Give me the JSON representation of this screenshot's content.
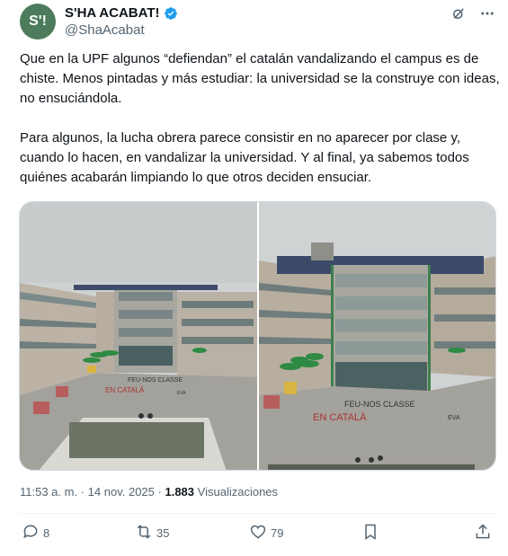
{
  "author": {
    "display_name": "S'HA ACABAT!",
    "handle": "@ShaAcabat",
    "avatar_text": "S'!",
    "verified": true
  },
  "tweet": {
    "paragraphs": [
      "Que en la UPF algunos “defiendan” el catalán vandalizando el campus es de chiste. Menos pintadas y más estudiar: la universidad se la construye con ideas, no ensuciándola.",
      "Para algunos, la lucha obrera parece consistir en no aparecer por clase y, cuando lo hacen, en vandalizar la universidad. Y al final, ya sabemos todos quiénes acabarán limpiando lo que otros deciden ensuciar."
    ]
  },
  "photos": [
    {
      "ground_text_1": "FEU-NOS CLASSE",
      "ground_text_2": "EN CATALÀ",
      "ground_text_3": "EVA"
    },
    {
      "ground_text_1": "FEU-NOS CLASSE",
      "ground_text_2": "EN CATALÀ",
      "ground_text_3": "EVA"
    }
  ],
  "meta": {
    "time": "11:53 a. m.",
    "separator": "·",
    "date": "14 nov. 2025",
    "views_count": "1.883",
    "views_label": "Visualizaciones"
  },
  "actions": {
    "replies": "8",
    "reposts": "35",
    "likes": "79"
  },
  "colors": {
    "text_primary": "#0f1419",
    "text_secondary": "#536471",
    "verified_blue": "#1d9bf0",
    "avatar_bg": "#4d7c5c"
  }
}
